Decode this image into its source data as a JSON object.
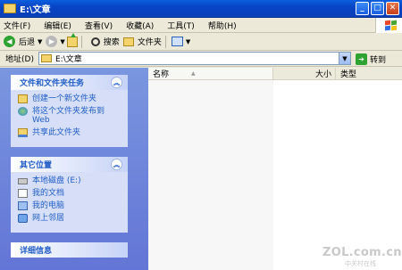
{
  "window": {
    "title": "E:\\文章"
  },
  "menubar": {
    "items": [
      "文件(F)",
      "编辑(E)",
      "查看(V)",
      "收藏(A)",
      "工具(T)",
      "帮助(H)"
    ]
  },
  "toolbar": {
    "back_label": "后退",
    "search_label": "搜索",
    "folders_label": "文件夹"
  },
  "addressbar": {
    "label": "地址(D)",
    "value": "E:\\文章",
    "go_label": "转到"
  },
  "taskpane": {
    "tasks_title": "文件和文件夹任务",
    "tasks": [
      "创建一个新文件夹",
      "将这个文件夹发布到 Web",
      "共享此文件夹"
    ],
    "places_title": "其它位置",
    "places": [
      "本地磁盘 (E:)",
      "我的文档",
      "我的电脑",
      "网上邻居"
    ],
    "details_title": "详细信息"
  },
  "filelist": {
    "columns": [
      "名称",
      "大小",
      "类型"
    ]
  },
  "watermark": {
    "main": "ZOL.com.cn",
    "sub": "中关村在线"
  },
  "colors": {
    "titlebar": "#0a5fe0",
    "taskpane": "#6375d6",
    "link": "#215dc6"
  }
}
